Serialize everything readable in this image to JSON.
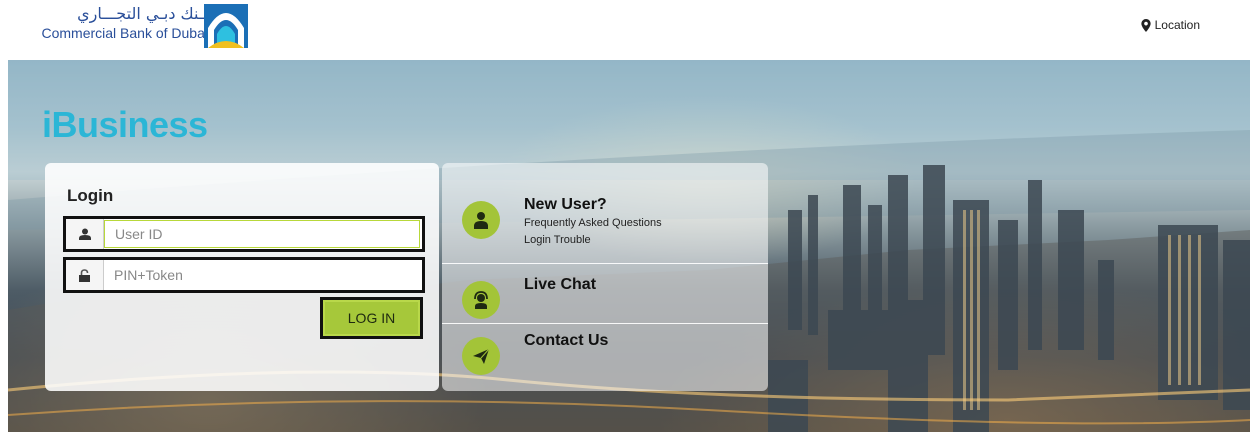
{
  "header": {
    "logo_arabic": "بـنك دبـي التجـــاري",
    "logo_english": "Commercial Bank of Dubai",
    "location_label": "Location"
  },
  "hero": {
    "brand": "iBusiness"
  },
  "login": {
    "title": "Login",
    "userid_placeholder": "User ID",
    "pin_placeholder": "PIN+Token",
    "button_label": "LOG IN"
  },
  "help": {
    "new_user_title": "New User?",
    "faq_link": "Frequently Asked Questions",
    "trouble_link": "Login Trouble",
    "live_chat": "Live Chat",
    "contact_us": "Contact Us"
  },
  "colors": {
    "brand_blue": "#2bb6d6",
    "accent_green": "#a6c83a",
    "logo_blue": "#2a4f9a"
  },
  "icons": {
    "location": "map-pin-icon",
    "user": "user-icon",
    "lock": "lock-icon",
    "new_user": "user-icon",
    "chat": "headset-agent-icon",
    "contact": "paper-plane-icon"
  }
}
